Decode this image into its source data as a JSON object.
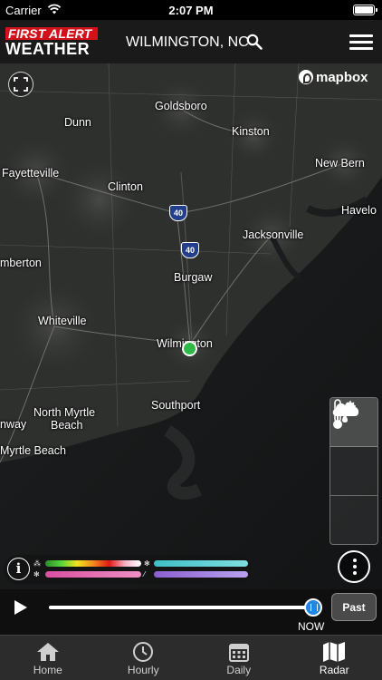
{
  "status_bar": {
    "carrier": "Carrier",
    "time": "2:07 PM"
  },
  "header": {
    "logo_line1": "FIRST ALERT",
    "logo_line2": "WEATHER",
    "location": "WILMINGTON, NC"
  },
  "map": {
    "attribution": "mapbox",
    "cities": [
      {
        "name": "Goldsboro"
      },
      {
        "name": "Dunn"
      },
      {
        "name": "Kinston"
      },
      {
        "name": "New Bern"
      },
      {
        "name": "Fayetteville"
      },
      {
        "name": "Clinton"
      },
      {
        "name": "Havelo"
      },
      {
        "name": "Jacksonville"
      },
      {
        "name": "mberton"
      },
      {
        "name": "Burgaw"
      },
      {
        "name": "Whiteville"
      },
      {
        "name": "Wilmington"
      },
      {
        "name": "Southport"
      },
      {
        "name": "North Myrtle"
      },
      {
        "name": "Beach"
      },
      {
        "name": "nway"
      },
      {
        "name": "Myrtle Beach"
      }
    ],
    "highway_shields": [
      "40",
      "40"
    ]
  },
  "layers": [
    {
      "icon": "precip-snow-icon",
      "active": true
    },
    {
      "icon": "thermometer-icon",
      "active": false
    },
    {
      "icon": "cloud-icon",
      "active": false
    }
  ],
  "legend": {
    "rain_colors": [
      "#2e8b2e",
      "#55d53b",
      "#f2e41e",
      "#f28a1e",
      "#e01818",
      "#f4b4c4",
      "#ffffff"
    ],
    "snow_colors": [
      "#3fbfc6",
      "#7fdde0"
    ],
    "mix_colors": [
      "#d94fa0",
      "#f08fc3"
    ],
    "ice_colors": [
      "#8a5fd0",
      "#b9a2ef"
    ]
  },
  "timeline": {
    "progress": 0.98,
    "now_label": "NOW",
    "past_label": "Past"
  },
  "tabs": [
    {
      "label": "Home",
      "icon": "home-icon",
      "active": false
    },
    {
      "label": "Hourly",
      "icon": "clock-history-icon",
      "active": false
    },
    {
      "label": "Daily",
      "icon": "calendar-icon",
      "active": false
    },
    {
      "label": "Radar",
      "icon": "map-icon",
      "active": true
    }
  ],
  "colors": {
    "accent": "#d1121a",
    "location_pin": "#2fb845",
    "slider_thumb": "#1e88e5"
  }
}
